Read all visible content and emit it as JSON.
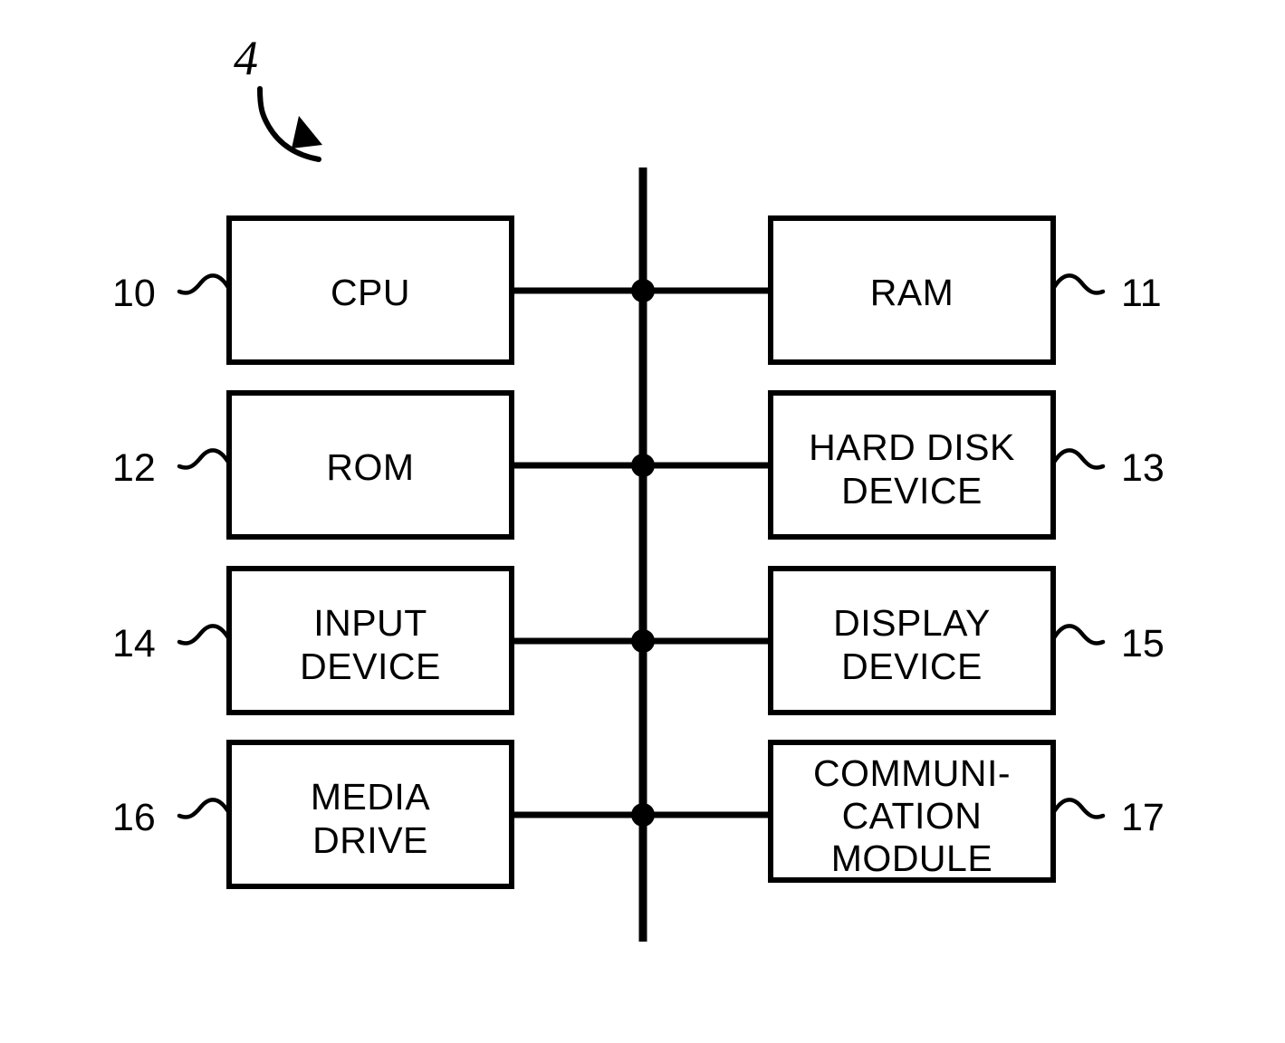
{
  "figure": {
    "label": "4",
    "label_name": "figure-reference-numeral",
    "background_color": "#ffffff",
    "line_color": "#000000"
  },
  "bus": {
    "name": "system-bus",
    "orientation": "vertical",
    "junction_count": 4
  },
  "blocks": [
    {
      "id": "cpu",
      "name": "block-cpu",
      "ref": "10",
      "ref_side": "left",
      "column": "left",
      "row": 1,
      "lines": [
        "CPU"
      ]
    },
    {
      "id": "ram",
      "name": "block-ram",
      "ref": "11",
      "ref_side": "right",
      "column": "right",
      "row": 1,
      "lines": [
        "RAM"
      ]
    },
    {
      "id": "rom",
      "name": "block-rom",
      "ref": "12",
      "ref_side": "left",
      "column": "left",
      "row": 2,
      "lines": [
        "ROM"
      ]
    },
    {
      "id": "hard-disk-device",
      "name": "block-hard-disk-device",
      "ref": "13",
      "ref_side": "right",
      "column": "right",
      "row": 2,
      "lines": [
        "HARD DISK",
        "DEVICE"
      ]
    },
    {
      "id": "input-device",
      "name": "block-input-device",
      "ref": "14",
      "ref_side": "left",
      "column": "left",
      "row": 3,
      "lines": [
        "INPUT",
        "DEVICE"
      ]
    },
    {
      "id": "display-device",
      "name": "block-display-device",
      "ref": "15",
      "ref_side": "right",
      "column": "right",
      "row": 3,
      "lines": [
        "DISPLAY",
        "DEVICE"
      ]
    },
    {
      "id": "media-drive",
      "name": "block-media-drive",
      "ref": "16",
      "ref_side": "left",
      "column": "left",
      "row": 4,
      "lines": [
        "MEDIA",
        "DRIVE"
      ]
    },
    {
      "id": "communication-module",
      "name": "block-communication-module",
      "ref": "17",
      "ref_side": "right",
      "column": "right",
      "row": 4,
      "lines": [
        "COMMUNI-",
        "CATION",
        "MODULE"
      ]
    }
  ],
  "text": {
    "cpu_l1": "CPU",
    "ram_l1": "RAM",
    "rom_l1": "ROM",
    "hdd_l1": "HARD DISK",
    "hdd_l2": "DEVICE",
    "input_l1": "INPUT",
    "input_l2": "DEVICE",
    "display_l1": "DISPLAY",
    "display_l2": "DEVICE",
    "media_l1": "MEDIA",
    "media_l2": "DRIVE",
    "comm_l1": "COMMUNI-",
    "comm_l2": "CATION",
    "comm_l3": "MODULE"
  },
  "refs": {
    "fig": "4",
    "r10": "10",
    "r11": "11",
    "r12": "12",
    "r13": "13",
    "r14": "14",
    "r15": "15",
    "r16": "16",
    "r17": "17"
  }
}
